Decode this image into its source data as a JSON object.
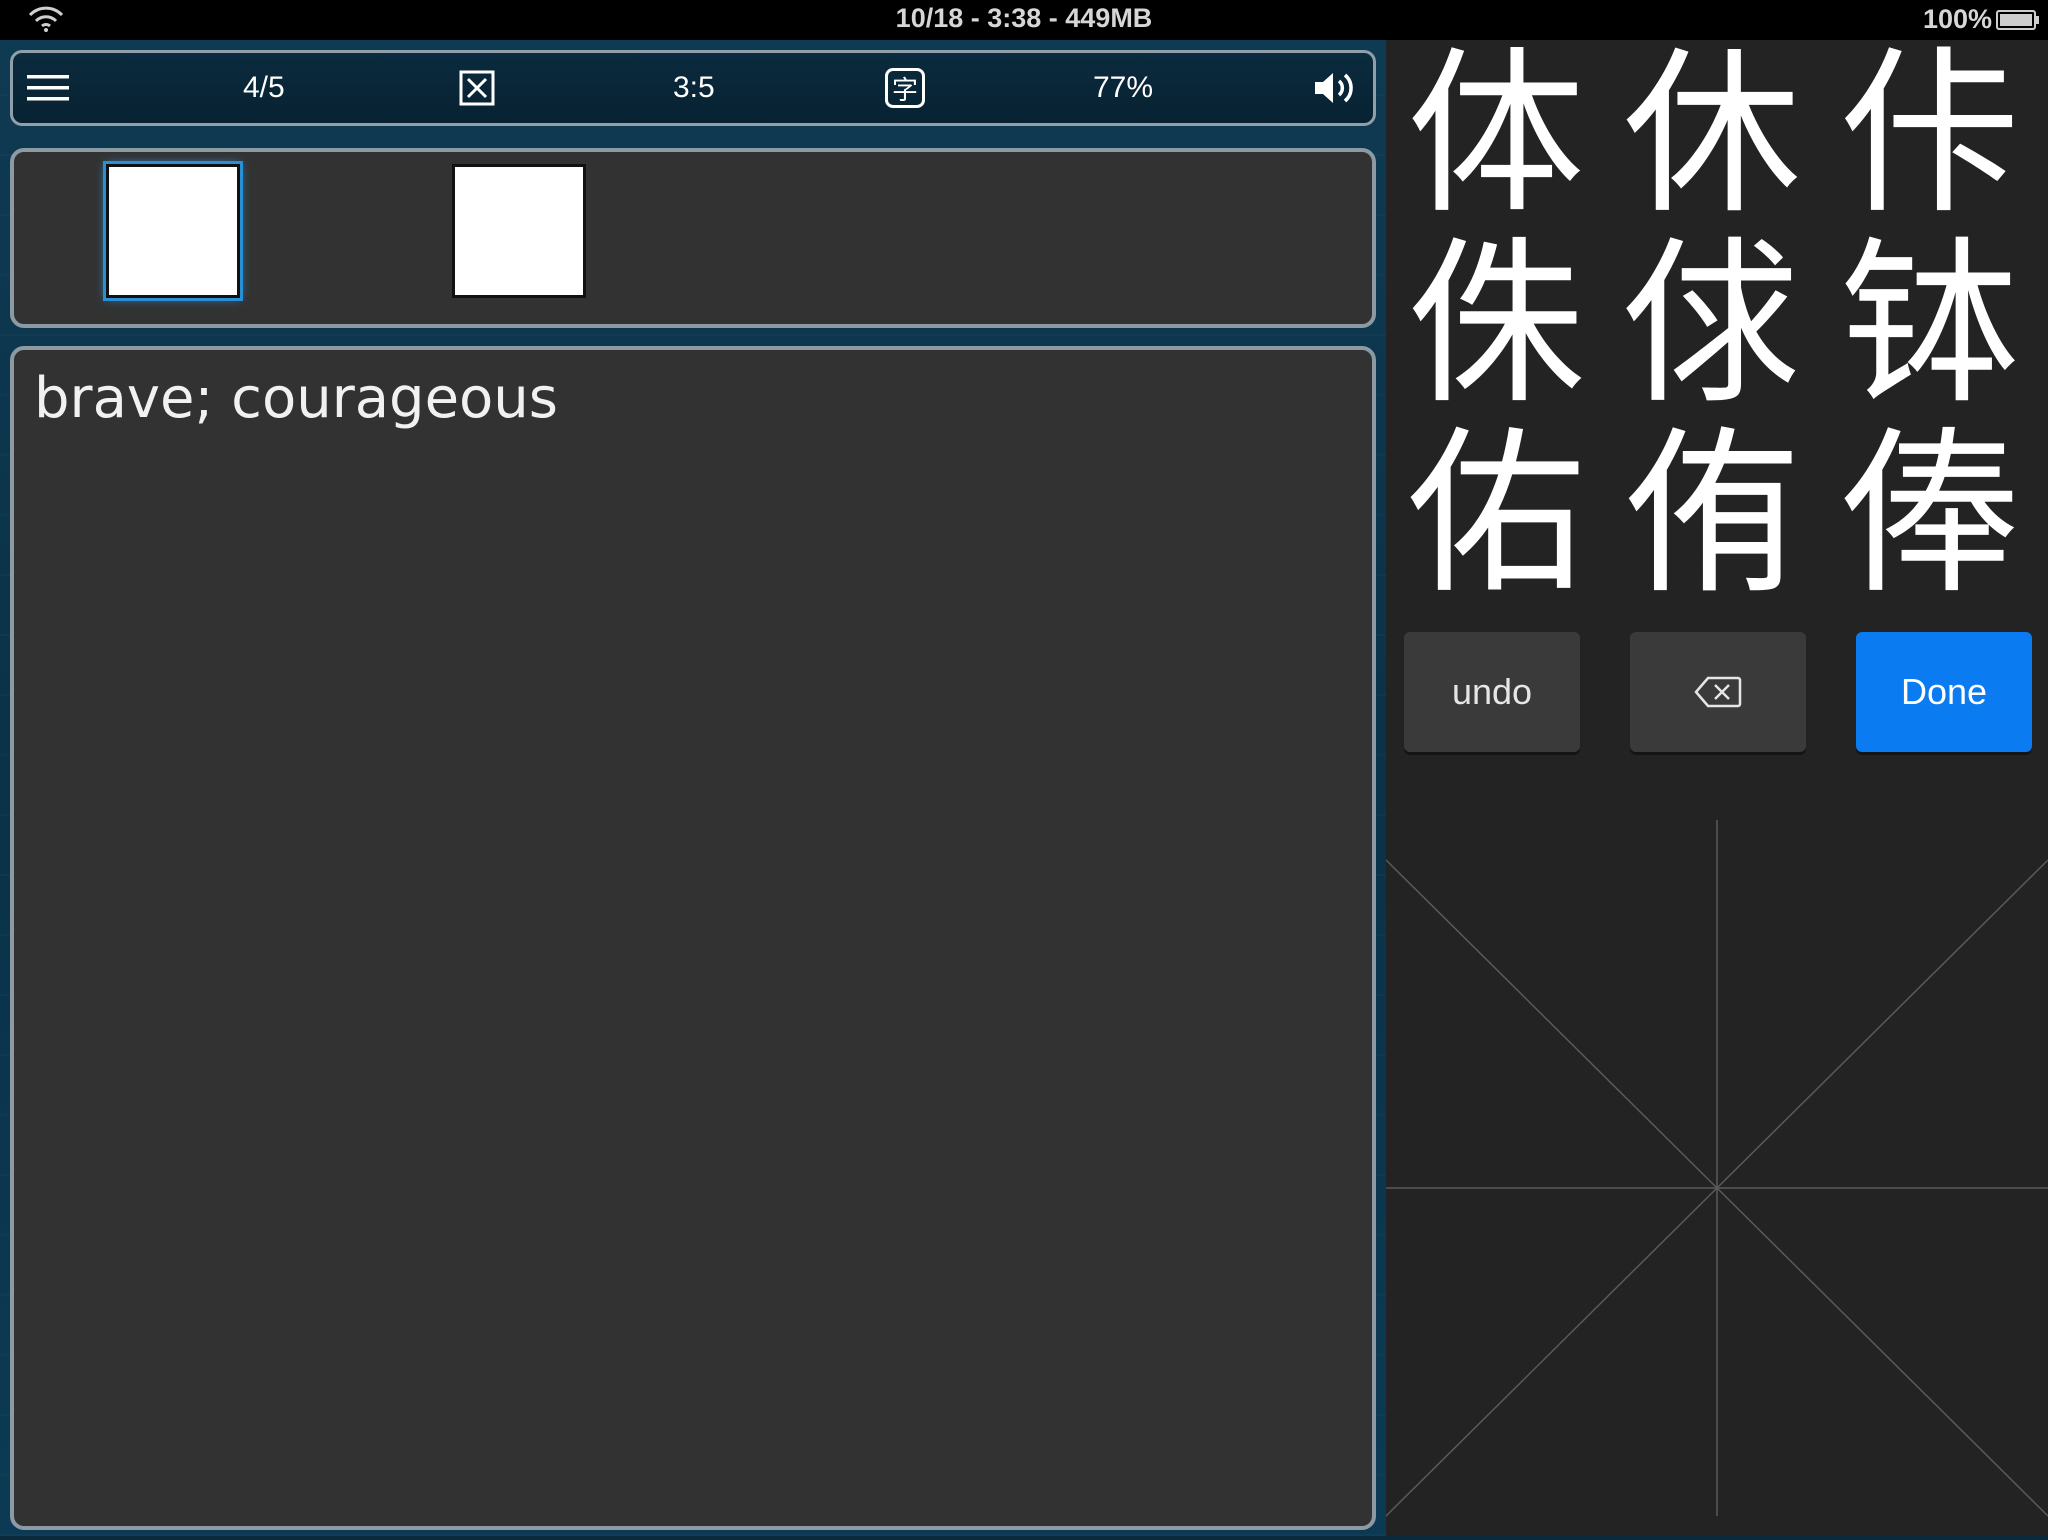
{
  "status_bar": {
    "center_text": "10/18 - 3:38 - 449MB",
    "battery_text": "100%"
  },
  "toolbar": {
    "progress": "4/5",
    "ratio": "3:5",
    "percent": "77%",
    "char_icon_glyph": "字"
  },
  "definition": {
    "text": "brave; courageous"
  },
  "candidates": [
    "体",
    "休",
    "佧",
    "侏",
    "俅",
    "钵",
    "佑",
    "侑",
    "俸"
  ],
  "buttons": {
    "undo_label": "undo",
    "done_label": "Done"
  },
  "colors": {
    "accent": "#0a7bf0",
    "selection": "#2a8fd4"
  }
}
